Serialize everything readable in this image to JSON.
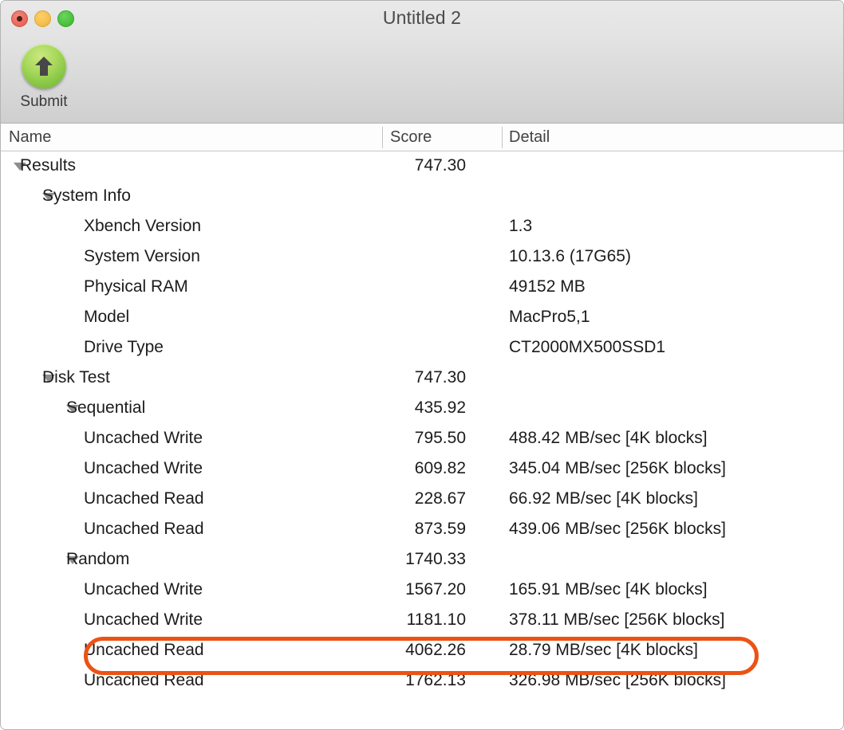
{
  "window": {
    "title": "Untitled 2",
    "traffic_lights": [
      "close",
      "minimize",
      "zoom"
    ]
  },
  "toolbar": {
    "submit_label": "Submit",
    "submit_icon": "upload-arrow-icon"
  },
  "columns": {
    "name": "Name",
    "score": "Score",
    "detail": "Detail"
  },
  "annotation": {
    "color": "#eb5315",
    "shape": "oval",
    "target_row": "Random Uncached Read 4K blocks"
  },
  "rows": [
    {
      "level": 0,
      "expanded": true,
      "name": "Results",
      "score": "747.30",
      "detail": ""
    },
    {
      "level": 1,
      "expanded": true,
      "name": "System Info",
      "score": "",
      "detail": ""
    },
    {
      "level": 3,
      "expanded": false,
      "name": "Xbench Version",
      "score": "",
      "detail": "1.3"
    },
    {
      "level": 3,
      "expanded": false,
      "name": "System Version",
      "score": "",
      "detail": "10.13.6 (17G65)"
    },
    {
      "level": 3,
      "expanded": false,
      "name": "Physical RAM",
      "score": "",
      "detail": "49152 MB"
    },
    {
      "level": 3,
      "expanded": false,
      "name": "Model",
      "score": "",
      "detail": "MacPro5,1"
    },
    {
      "level": 3,
      "expanded": false,
      "name": "Drive Type",
      "score": "",
      "detail": "CT2000MX500SSD1"
    },
    {
      "level": 1,
      "expanded": true,
      "name": "Disk Test",
      "score": "747.30",
      "detail": ""
    },
    {
      "level": 2,
      "expanded": true,
      "name": "Sequential",
      "score": "435.92",
      "detail": ""
    },
    {
      "level": 3,
      "expanded": false,
      "name": "Uncached Write",
      "score": "795.50",
      "detail": "488.42 MB/sec [4K blocks]"
    },
    {
      "level": 3,
      "expanded": false,
      "name": "Uncached Write",
      "score": "609.82",
      "detail": "345.04 MB/sec [256K blocks]"
    },
    {
      "level": 3,
      "expanded": false,
      "name": "Uncached Read",
      "score": "228.67",
      "detail": "66.92 MB/sec [4K blocks]"
    },
    {
      "level": 3,
      "expanded": false,
      "name": "Uncached Read",
      "score": "873.59",
      "detail": "439.06 MB/sec [256K blocks]"
    },
    {
      "level": 2,
      "expanded": true,
      "name": "Random",
      "score": "1740.33",
      "detail": ""
    },
    {
      "level": 3,
      "expanded": false,
      "name": "Uncached Write",
      "score": "1567.20",
      "detail": "165.91 MB/sec [4K blocks]"
    },
    {
      "level": 3,
      "expanded": false,
      "name": "Uncached Write",
      "score": "1181.10",
      "detail": "378.11 MB/sec [256K blocks]"
    },
    {
      "level": 3,
      "expanded": false,
      "name": "Uncached Read",
      "score": "4062.26",
      "detail": "28.79 MB/sec [4K blocks]"
    },
    {
      "level": 3,
      "expanded": false,
      "name": "Uncached Read",
      "score": "1762.13",
      "detail": "326.98 MB/sec [256K blocks]"
    }
  ]
}
